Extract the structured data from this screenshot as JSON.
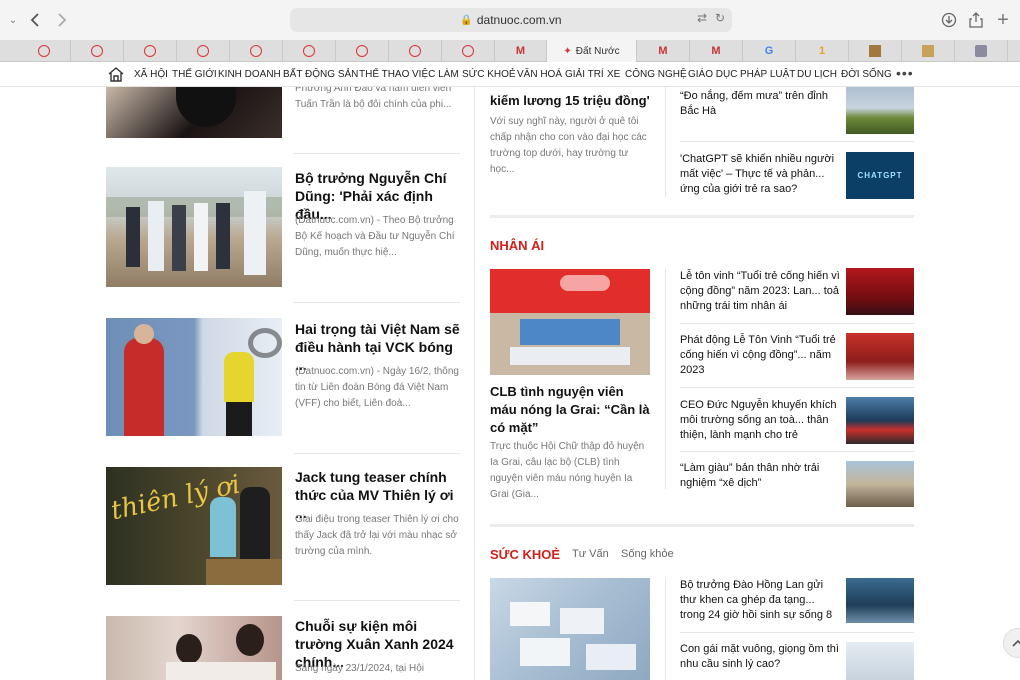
{
  "browser": {
    "url": "datnuoc.com.vn",
    "active_tab_title": "Đất Nước",
    "tabs": [
      {
        "icon": "circle-r-favicon"
      },
      {
        "icon": "circle-r-favicon"
      },
      {
        "icon": "circle-r-favicon"
      },
      {
        "icon": "circle-r-favicon"
      },
      {
        "icon": "circle-r-favicon"
      },
      {
        "icon": "circle-r-favicon"
      },
      {
        "icon": "circle-r-favicon"
      },
      {
        "icon": "circle-r-favicon"
      },
      {
        "icon": "gmail-favicon"
      },
      {
        "icon": "datnuoc-favicon"
      },
      {
        "icon": "gmail-favicon"
      },
      {
        "icon": "gmail-favicon"
      },
      {
        "icon": "google-favicon"
      },
      {
        "icon": "one-favicon"
      },
      {
        "icon": "picture-favicon"
      },
      {
        "icon": "box-favicon"
      },
      {
        "icon": "p-favicon"
      }
    ]
  },
  "nav": {
    "items": [
      "XÃ HỘI",
      "THẾ GIỚI",
      "KINH DOANH",
      "BẤT ĐỘNG SẢN",
      "THỂ THAO",
      "VIỆC LÀM",
      "SỨC KHOẺ",
      "VĂN HOÁ",
      "GIẢI TRÍ",
      "XE",
      "CÔNG NGHỆ",
      "GIÁO DỤC",
      "PHÁP LUẬT",
      "DU LỊCH",
      "ĐỜI SỐNG"
    ],
    "more": "•••"
  },
  "left": {
    "top_partial": {
      "summary": "Phương Anh Đào và nam diễn viên Tuấn Trần là bộ đôi chính của phi..."
    },
    "articles": [
      {
        "title": "Bộ trưởng Nguyễn Chí Dũng: 'Phải xác định đầu...",
        "summary": "(Datnuoc.com.vn) - Theo Bộ trưởng Bộ Kế hoạch và Đầu tư Nguyễn Chí Dũng, muốn thực hiệ..."
      },
      {
        "title": "Hai trọng tài Việt Nam sẽ điều hành tại VCK bóng ...",
        "summary": "(Datnuoc.com.vn) - Ngày 16/2, thông tin từ Liên đoàn Bóng đá Việt Nam (VFF) cho biết, Liên đoà..."
      },
      {
        "title": "Jack tung teaser chính thức của MV Thiên lý ơi ...",
        "summary": "Giai điệu trong teaser Thiên lý ơi cho thấy Jack đã trở lại với màu nhạc sở trường của mình.",
        "thumb_text": "thiên lý ơi"
      },
      {
        "title": "Chuỗi sự kiện môi trường Xuân Xanh 2024 chính...",
        "summary": "Sáng ngày 23/1/2024, tại Hội"
      }
    ]
  },
  "top_mid": {
    "title": "kiếm lương 15 triệu đồng'",
    "summary": "Với suy nghĩ này, người ở quê tôi chấp nhận cho con vào đại học các trường top dưới, hay trường tư học..."
  },
  "top_side": [
    {
      "title": "“Đo nắng, đếm mưa” trên đỉnh Bắc Hà"
    },
    {
      "title": "'ChatGPT sẽ khiến nhiều người mất việc' – Thực tế và phản... ứng của giới trẻ ra sao?",
      "thumb_text": "CHATGPT"
    }
  ],
  "nhan_ai": {
    "section": "NHÂN ÁI",
    "main": {
      "title": "CLB tình nguyện viên máu nóng la Grai: “Cần là có mặt”",
      "summary": "Trực thuộc Hội Chữ thập đỏ huyện Ia Grai, câu lạc bộ (CLB) tình nguyện viên máu nóng huyện Ia Grai (Gia..."
    },
    "side": [
      {
        "title": " Lễ tôn vinh “Tuổi trẻ cống hiến vì cộng đồng” năm 2023: Lan... toả những trái tim nhân ái"
      },
      {
        "title": "Phát động Lễ Tôn Vinh “Tuổi trẻ cống hiến vì cộng đồng”... năm 2023"
      },
      {
        "title": "CEO Đức Nguyễn khuyến khích môi trường sống an toà... thân thiện, lành mạnh cho trẻ"
      },
      {
        "title": "“Làm giàu” bản thân nhờ trải nghiệm “xê dịch”"
      }
    ]
  },
  "suc_khoe": {
    "section": "SỨC KHOẺ",
    "sub1": "Tư Vấn",
    "sub2": "Sống khỏe",
    "side": [
      {
        "title": "Bộ trưởng Đào Hồng Lan gửi thư khen ca ghép đa tạng... trong 24 giờ hồi sinh sự sống 8"
      },
      {
        "title": "Con gái mặt vuông, giọng ồm thì nhu cầu sinh lý cao?"
      }
    ]
  },
  "colors": {
    "accent": "#d0201a",
    "toolbar": "#f4f4f4",
    "tabstrip": "#dedede"
  }
}
